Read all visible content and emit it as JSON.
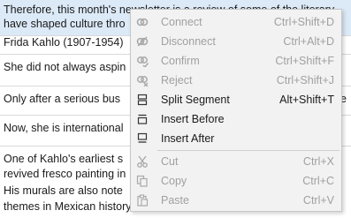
{
  "document": {
    "segments": [
      {
        "lines": [
          "Therefore, this month's newsletter is a review of some of the literary",
          "have shaped culture thro"
        ],
        "selected": true
      },
      {
        "lines": [
          "Frida Kahlo (1907-1954)"
        ],
        "selected": false
      },
      {
        "lines": [
          "She did not always aspin"
        ],
        "selected": false
      },
      {
        "lines": [
          "Only after a serious bus",
          "be"
        ],
        "selected": false
      },
      {
        "lines": [
          "Now, she is international"
        ],
        "selected": false
      },
      {
        "lines": [
          "One of Kahlo's earliest s",
          "revived fresco painting in",
          "His murals are also note",
          "themes in Mexican history"
        ],
        "selected": false
      }
    ]
  },
  "context_menu": {
    "items": [
      {
        "label": "Connect",
        "shortcut": "Ctrl+Shift+D",
        "icon": "link-icon",
        "enabled": false
      },
      {
        "label": "Disconnect",
        "shortcut": "Ctrl+Alt+D",
        "icon": "unlink-icon",
        "enabled": false
      },
      {
        "label": "Confirm",
        "shortcut": "Ctrl+Shift+F",
        "icon": "confirm-link-icon",
        "enabled": false
      },
      {
        "label": "Reject",
        "shortcut": "Ctrl+Shift+J",
        "icon": "reject-link-icon",
        "enabled": false
      },
      {
        "label": "Split Segment",
        "shortcut": "Alt+Shift+T",
        "icon": "split-segment-icon",
        "enabled": true
      },
      {
        "label": "Insert Before",
        "shortcut": "",
        "icon": "insert-before-icon",
        "enabled": true
      },
      {
        "label": "Insert After",
        "shortcut": "",
        "icon": "insert-after-icon",
        "enabled": true
      },
      {
        "label": "Cut",
        "shortcut": "Ctrl+X",
        "icon": "scissors-icon",
        "enabled": false
      },
      {
        "label": "Copy",
        "shortcut": "Ctrl+C",
        "icon": "copy-icon",
        "enabled": false
      },
      {
        "label": "Paste",
        "shortcut": "Ctrl+V",
        "icon": "paste-icon",
        "enabled": false
      }
    ]
  },
  "colors": {
    "selection": "#dce9f7",
    "disabled_text": "#a0a0a0",
    "menu_background": "#f2f2f2"
  }
}
